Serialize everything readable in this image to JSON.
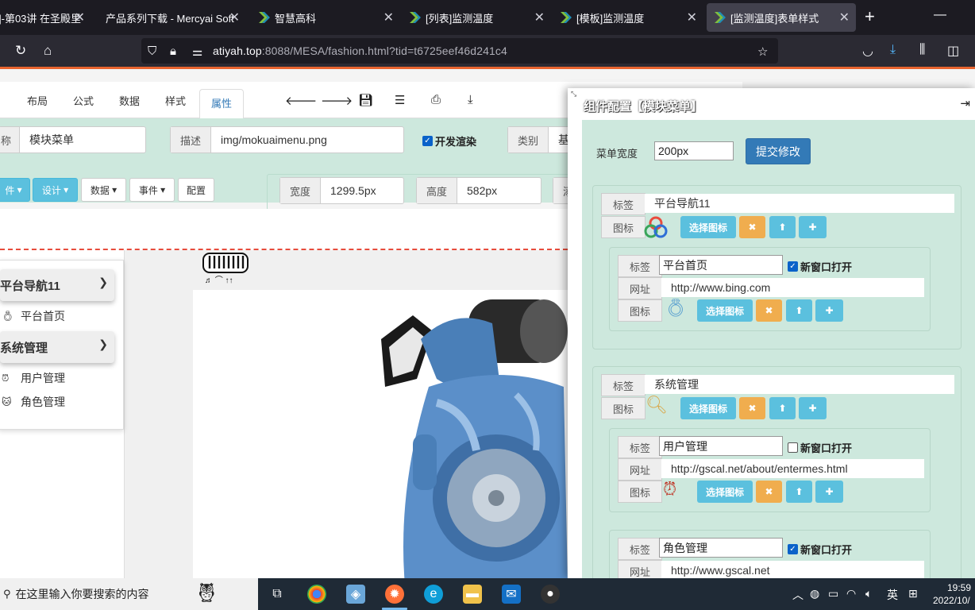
{
  "browser": {
    "tabs": [
      {
        "label": "]-第03讲 在圣殿里",
        "active": false
      },
      {
        "label": "产品系列下载 - Mercyai Soft",
        "active": false
      },
      {
        "label": "智慧高科",
        "active": false
      },
      {
        "label": "[列表]监测温度",
        "active": false
      },
      {
        "label": "[模板]监测温度",
        "active": false
      },
      {
        "label": "[监测温度]表单样式",
        "active": true
      }
    ],
    "url_host": "atiyah.top",
    "url_rest": ":8088/MESA/fashion.html?tid=t6725eef46d241c4"
  },
  "menubar": {
    "tabs": [
      "布局",
      "公式",
      "数据",
      "样式",
      "属性"
    ],
    "active_tab": "属性"
  },
  "props": {
    "name_label": "称",
    "name_value": "模块菜单",
    "desc_label": "描述",
    "desc_value": "img/mokuaimenu.png",
    "dev_render_label": "开发渲染",
    "category_label": "类别",
    "category_value": "基",
    "btn_component": "件",
    "btn_design": "设计",
    "btn_data": "数据",
    "btn_event": "事件",
    "btn_config": "配置",
    "width_label": "宽度",
    "width_value": "1299.5px",
    "height_label": "高度",
    "height_value": "582px",
    "extra_label": "添"
  },
  "preview": {
    "groups": [
      {
        "title": "平台导航11",
        "items": [
          "平台首页"
        ]
      },
      {
        "title": "系统管理",
        "items": [
          "用户管理",
          "角色管理"
        ]
      }
    ],
    "snippet_text": "♬ ⌒ ↑↑"
  },
  "dialog": {
    "title": "组件配置【模块菜单】",
    "menu_width_label": "菜单宽度",
    "menu_width_value": "200px",
    "submit_label": "提交修改",
    "label_text": "标签",
    "icon_text": "图标",
    "url_text": "网址",
    "choose_icon": "选择图标",
    "new_window": "新窗口打开",
    "groups": [
      {
        "label": "平台导航11",
        "icon": "rings-icon",
        "items": [
          {
            "label": "平台首页",
            "url": "http://www.bing.com",
            "new_window": true,
            "icon": "ring-icon"
          }
        ]
      },
      {
        "label": "系统管理",
        "icon": "magnifier-icon",
        "items": [
          {
            "label": "用户管理",
            "url": "http://gscal.net/about/entermes.html",
            "new_window": false,
            "icon": "alarm-clock-icon"
          },
          {
            "label": "角色管理",
            "url": "http://www.gscal.net",
            "new_window": true,
            "icon": "cat-icon"
          }
        ]
      }
    ]
  },
  "taskbar": {
    "search_placeholder": "在这里输入你要搜索的内容",
    "ime": "英",
    "time": "19:59",
    "date": "2022/10/"
  }
}
